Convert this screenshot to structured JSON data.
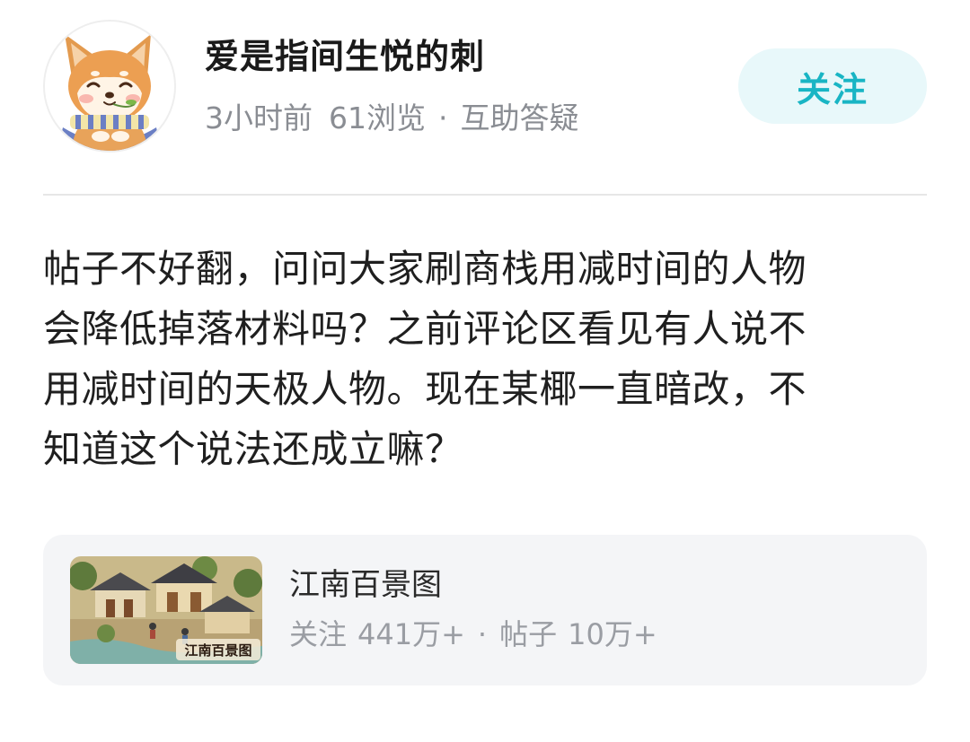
{
  "author": {
    "name": "爱是指间生悦的刺",
    "avatar_icon": "shiba-dog-avatar"
  },
  "meta": {
    "time": "3小时前",
    "views": "61浏览",
    "separator": "·",
    "category": "互助答疑"
  },
  "follow_button": {
    "label": "关注",
    "text_color": "#19b5c4",
    "bg_color": "#e8f8fa"
  },
  "post": {
    "lines": [
      "帖子不好翻，问问大家刷商栈用减时间的人物",
      "会降低掉落材料吗？之前评论区看见有人说不",
      "用减时间的天极人物。现在某椰一直暗改，不",
      "知道这个说法还成立嘛？"
    ]
  },
  "game_card": {
    "title": "江南百景图",
    "followers_label": "关注",
    "followers_count": "441万+",
    "separator": "·",
    "posts_label": "帖子",
    "posts_count": "10万+",
    "thumb_logo_text": "江南百景图",
    "thumb_icon": "game-artwork-thumbnail"
  }
}
